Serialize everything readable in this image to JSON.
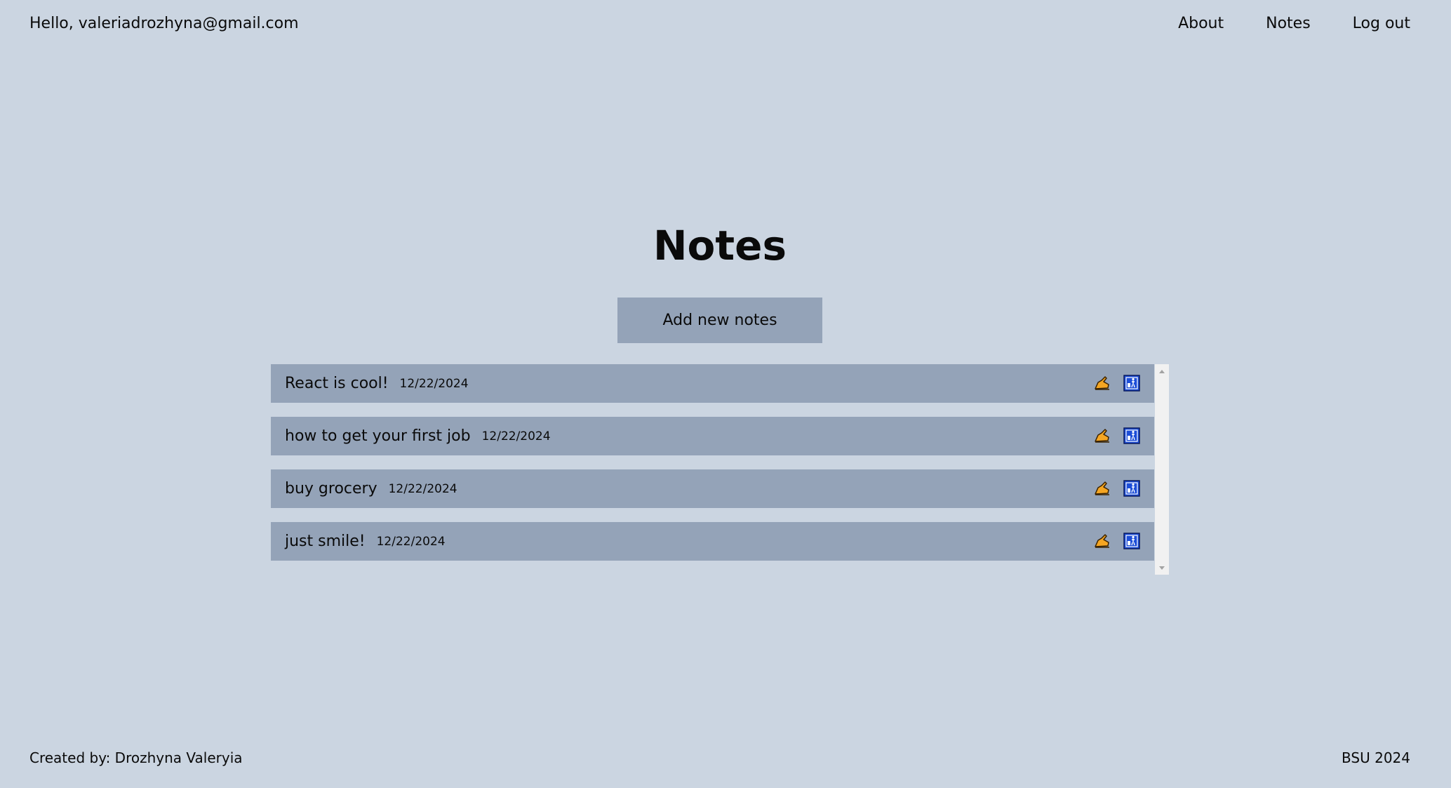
{
  "header": {
    "greeting": "Hello, valeriadrozhyna@gmail.com",
    "nav": {
      "about": "About",
      "notes": "Notes",
      "logout": "Log out"
    }
  },
  "main": {
    "title": "Notes",
    "add_button": "Add new notes",
    "notes": [
      {
        "title": "React is cool!",
        "date": "12/22/2024"
      },
      {
        "title": "how to get your first job",
        "date": "12/22/2024"
      },
      {
        "title": "buy grocery",
        "date": "12/22/2024"
      },
      {
        "title": "just smile!",
        "date": "12/22/2024"
      }
    ],
    "note_icons": {
      "edit": "writing-hand-icon",
      "delete": "trash-icon"
    }
  },
  "footer": {
    "left": "Created by: Drozhyna Valeryia",
    "right": "BSU 2024"
  },
  "colors": {
    "background": "#cbd5e1",
    "panel": "#94a3b8",
    "edit_icon": "#f5a623",
    "delete_icon": "#1d4ed8"
  }
}
